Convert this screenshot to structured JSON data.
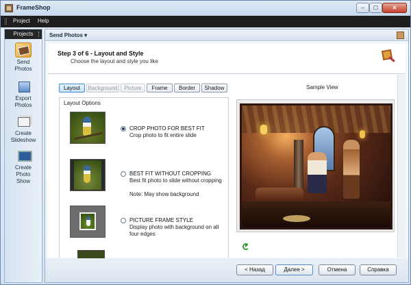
{
  "window": {
    "title": "FrameShop",
    "controls": {
      "minimize": "–",
      "maximize": "☐",
      "close": "✕"
    }
  },
  "menu": {
    "items": [
      "Project",
      "Help"
    ]
  },
  "sidebar": {
    "header": "Projects",
    "items": [
      {
        "label_line1": "Send",
        "label_line2": "Photos",
        "icon": "send-photos-icon",
        "selected": true
      },
      {
        "label_line1": "Export",
        "label_line2": "Photos",
        "icon": "export-photos-icon",
        "selected": false
      },
      {
        "label_line1": "Create",
        "label_line2": "Slideshow",
        "icon": "slideshow-icon",
        "selected": false
      },
      {
        "label_line1": "Create",
        "label_line2": "Photo",
        "label_line3": "Show",
        "icon": "photo-show-icon",
        "selected": false
      }
    ]
  },
  "main": {
    "header_title": "Send Photos",
    "header_arrow": "▾",
    "step_title": "Step 3 of 6 - Layout and Style",
    "step_subtitle": "Choose the layout and style you like"
  },
  "tabs": [
    {
      "label": "Layout",
      "state": "active"
    },
    {
      "label": "Background",
      "state": "disabled"
    },
    {
      "label": "Picture",
      "state": "disabled"
    },
    {
      "label": "Frame",
      "state": "normal"
    },
    {
      "label": "Border",
      "state": "normal"
    },
    {
      "label": "Shadow",
      "state": "normal"
    }
  ],
  "layout_options": {
    "group_label": "Layout Options",
    "options": [
      {
        "title": "CROP PHOTO FOR BEST FIT",
        "desc": "Crop photo to fit entire slide",
        "selected": true
      },
      {
        "title": "BEST FIT WITHOUT CROPPING",
        "desc": "Best fit photo to slide without cropping",
        "note": "Note: May show background",
        "selected": false
      },
      {
        "title": "PICTURE FRAME STYLE",
        "desc": "Display photo with background on all four edges",
        "selected": false
      }
    ]
  },
  "sample_view": {
    "label": "Sample View"
  },
  "buttons": {
    "back": "< Назад",
    "next": "Далее >",
    "cancel": "Отмена",
    "help": "Справка"
  },
  "colors": {
    "menubar": "#1f1f1f",
    "active_tab": "#3d8ad8",
    "close_button": "#c4412c",
    "selected_sidebar": "#f0c060"
  }
}
